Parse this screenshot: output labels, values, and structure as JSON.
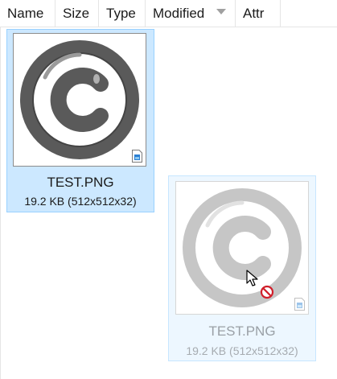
{
  "header": {
    "columns": [
      {
        "label": "Name"
      },
      {
        "label": "Size"
      },
      {
        "label": "Type"
      },
      {
        "label": "Modified"
      },
      {
        "label": "Attr"
      }
    ],
    "sort_column": "Modified",
    "sort_direction": "descending"
  },
  "files": [
    {
      "name": "TEST.PNG",
      "meta": "19.2 KB (512x512x32)",
      "state": "selected",
      "icon": "copyright-icon"
    },
    {
      "name": "TEST.PNG",
      "meta": "19.2 KB (512x512x32)",
      "state": "drag-ghost",
      "icon": "copyright-icon"
    }
  ],
  "overlay": {
    "cursor": "arrow-cursor",
    "drop_indicator": "no-drop-icon"
  },
  "colors": {
    "selection_fill": "#cce8ff",
    "selection_border": "#99d1ff",
    "icon_dark": "#555555",
    "icon_light": "#c8c8c8",
    "no_drop_red": "#d01f2b"
  }
}
